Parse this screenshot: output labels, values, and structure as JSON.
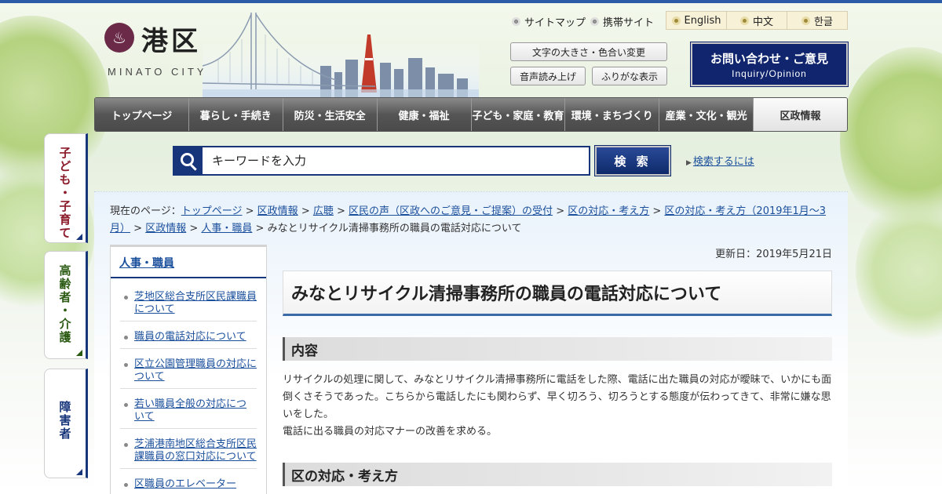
{
  "header": {
    "logo_mark": "♨",
    "logo_text": "港区",
    "logo_sub": "MINATO CITY",
    "links": [
      "サイトマップ",
      "携帯サイト"
    ],
    "languages": [
      "English",
      "中文",
      "한글"
    ],
    "text_size_button": "文字の大きさ・色合い変更",
    "voice_button": "音声読み上げ",
    "furigana_button": "ふりがな表示",
    "inquiry_line1": "お問い合わせ・ご意見",
    "inquiry_line2": "Inquiry/Opinion"
  },
  "gnav": [
    "トップページ",
    "暮らし・手続き",
    "防災・生活安全",
    "健康・福祉",
    "子ども・家庭・教育",
    "環境・まちづくり",
    "産業・文化・観光",
    "区政情報"
  ],
  "side_tabs": [
    {
      "label": "子ども・子育て",
      "color": "#8b1a2a"
    },
    {
      "label": "高齢者・介護",
      "color": "#2a5a12"
    },
    {
      "label": "障害者",
      "color": "#16357a"
    }
  ],
  "search": {
    "placeholder": "キーワードを入力",
    "button": "検 索",
    "help": "検索するには"
  },
  "breadcrumb": {
    "prefix": "現在のページ：",
    "items": [
      "トップページ",
      "区政情報",
      "広聴",
      "区民の声（区政へのご意見・ご提案）の受付",
      "区の対応・考え方",
      "区の対応・考え方（2019年1月～3月）",
      "区政情報",
      "人事・職員"
    ],
    "current": "みなとリサイクル清掃事務所の職員の電話対応について",
    "sep": " > "
  },
  "updated": "更新日：2019年5月21日",
  "sidebar": {
    "title": "人事・職員",
    "items": [
      "芝地区総合支所区民課職員について",
      "職員の電話対応について",
      "区立公園管理職員の対応について",
      "若い職員全般の対応について",
      "芝浦港南地区総合支所区民課職員の窓口対応について",
      "区職員のエレベーター"
    ]
  },
  "article": {
    "title": "みなとリサイクル清掃事務所の職員の電話対応について",
    "h2_content": "内容",
    "paragraph1": "リサイクルの処理に関して、みなとリサイクル清掃事務所に電話をした際、電話に出た職員の対応が曖昧で、いかにも面倒くさそうであった。こちらから電話したにも関わらず、早く切ろう、切ろうとする態度が伝わってきて、非常に嫌な思いをした。",
    "paragraph2": "電話に出る職員の対応マナーの改善を求める。",
    "h2_response": "区の対応・考え方"
  },
  "colors": {
    "accent": "#16357a",
    "link": "#1a4f9c",
    "top_line": "#2b5aa6"
  }
}
